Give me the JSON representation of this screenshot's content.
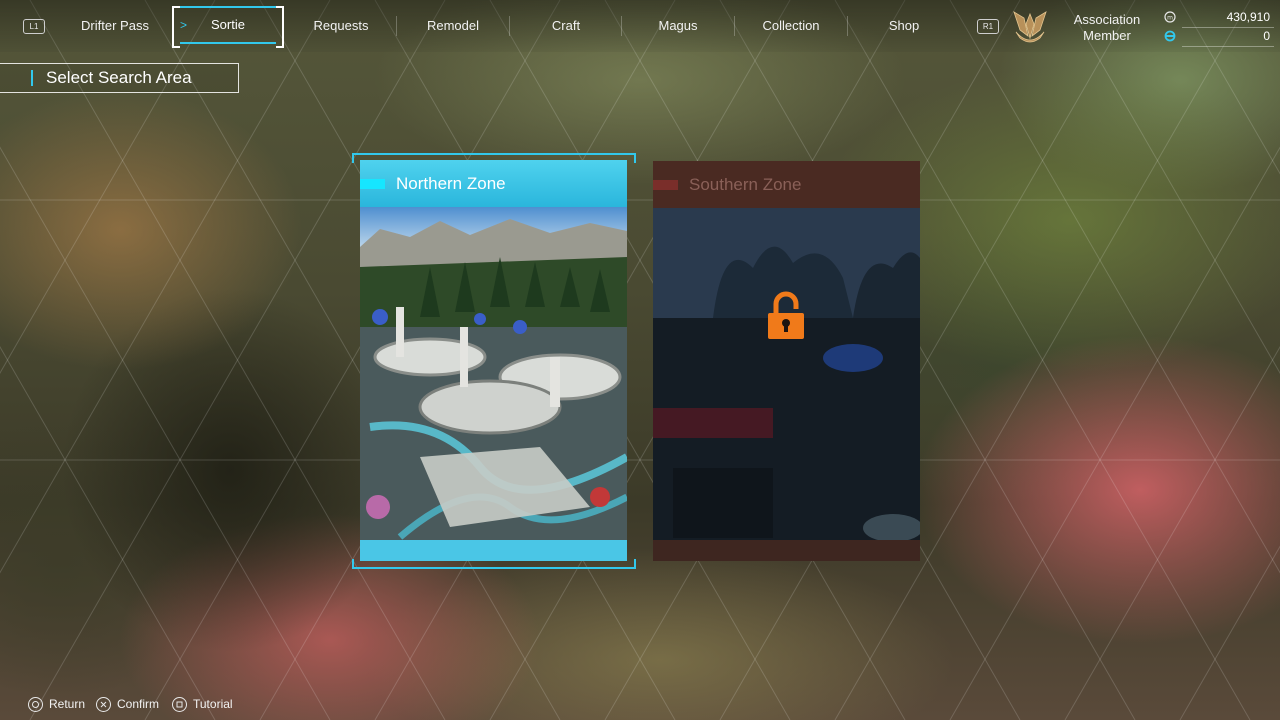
{
  "nav": {
    "l1": "L1",
    "r1": "R1",
    "items": [
      {
        "label": "Drifter Pass"
      },
      {
        "label": "Sortie"
      },
      {
        "label": "Requests"
      },
      {
        "label": "Remodel"
      },
      {
        "label": "Craft"
      },
      {
        "label": "Magus"
      },
      {
        "label": "Collection"
      },
      {
        "label": "Shop"
      }
    ],
    "active_index": 1
  },
  "status": {
    "rank_line1": "Association",
    "rank_line2": "Member",
    "currency_1": "430,910",
    "currency_2": "0",
    "currency_1_icon": "coin-icon",
    "currency_2_icon": "refresh-currency-icon"
  },
  "header": {
    "title": "Select Search Area"
  },
  "areas": [
    {
      "name": "Northern Zone",
      "state": "selected"
    },
    {
      "name": "Southern Zone",
      "state": "locked"
    }
  ],
  "footer": {
    "return": "Return",
    "confirm": "Confirm",
    "tutorial": "Tutorial"
  },
  "colors": {
    "accent": "#32c8ec",
    "lock": "#f07a1a",
    "locked_header": "#4a2a22"
  }
}
